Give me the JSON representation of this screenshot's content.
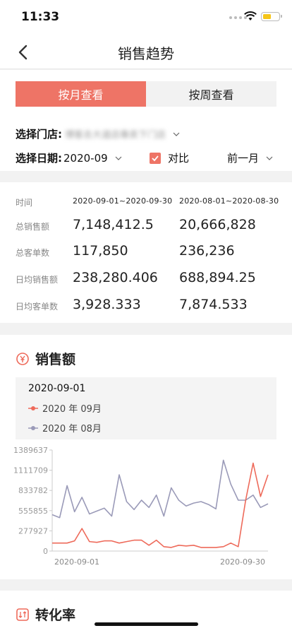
{
  "status": {
    "time": "11:33"
  },
  "nav": {
    "title": "销售趋势"
  },
  "tabs": [
    {
      "label": "按月查看"
    },
    {
      "label": "按周查看"
    }
  ],
  "filters": {
    "store_label": "选择门店:",
    "store_value": "博客去大道店專卖下门店",
    "date_label": "选择日期:",
    "date_value": "2020-09",
    "compare_label": "对比",
    "period_value": "前一月"
  },
  "summary": {
    "header": {
      "label": "时间",
      "v1": "2020-09-01~2020-09-30",
      "v2": "2020-08-01~2020-08-30"
    },
    "rows": [
      {
        "label": "总销售额",
        "v1": "7,148,412.5",
        "v2": "20,666,828"
      },
      {
        "label": "总客单数",
        "v1": "117,850",
        "v2": "236,236"
      },
      {
        "label": "日均销售额",
        "v1": "238,280.406",
        "v2": "688,894.25"
      },
      {
        "label": "日均客单数",
        "v1": "3,928.333",
        "v2": "7,874.533"
      }
    ]
  },
  "sales_section": {
    "title": "销售额",
    "legend_date": "2020-09-01",
    "legend": [
      {
        "name": "2020 年 09月"
      },
      {
        "name": "2020 年 08月"
      }
    ]
  },
  "conversion_section": {
    "title": "转化率"
  },
  "colors": {
    "accent": "#ee7466",
    "series_sep": "#ee6a5a",
    "series_aug": "#9a9ab8"
  },
  "chart_data": {
    "type": "line",
    "x_tick_labels": [
      "2020-09-01",
      "2020-09-30"
    ],
    "y_ticks": [
      0,
      277927,
      555855,
      833782,
      1111709,
      1389637
    ],
    "y_tick_labels": [
      "0",
      "277927",
      "555855",
      "833782",
      "1111709",
      "1389637"
    ],
    "ylim": [
      0,
      1389637
    ],
    "x": [
      1,
      2,
      3,
      4,
      5,
      6,
      7,
      8,
      9,
      10,
      11,
      12,
      13,
      14,
      15,
      16,
      17,
      18,
      19,
      20,
      21,
      22,
      23,
      24,
      25,
      26,
      27,
      28,
      29,
      30
    ],
    "series": [
      {
        "name": "2020 年 09月",
        "color": "#ee6a5a",
        "values": [
          110000,
          110000,
          110000,
          140000,
          310000,
          130000,
          120000,
          140000,
          140000,
          110000,
          130000,
          150000,
          150000,
          80000,
          150000,
          60000,
          50000,
          80000,
          70000,
          80000,
          50000,
          50000,
          50000,
          60000,
          110000,
          60000,
          700000,
          1210000,
          750000,
          1050000
        ]
      },
      {
        "name": "2020 年 08月",
        "color": "#9a9ab8",
        "values": [
          500000,
          460000,
          900000,
          540000,
          740000,
          510000,
          550000,
          590000,
          480000,
          1050000,
          680000,
          570000,
          700000,
          600000,
          770000,
          480000,
          870000,
          700000,
          620000,
          660000,
          680000,
          640000,
          580000,
          1250000,
          920000,
          700000,
          700000,
          770000,
          600000,
          650000
        ]
      }
    ],
    "grid": false,
    "legend_placement": "top-left"
  }
}
